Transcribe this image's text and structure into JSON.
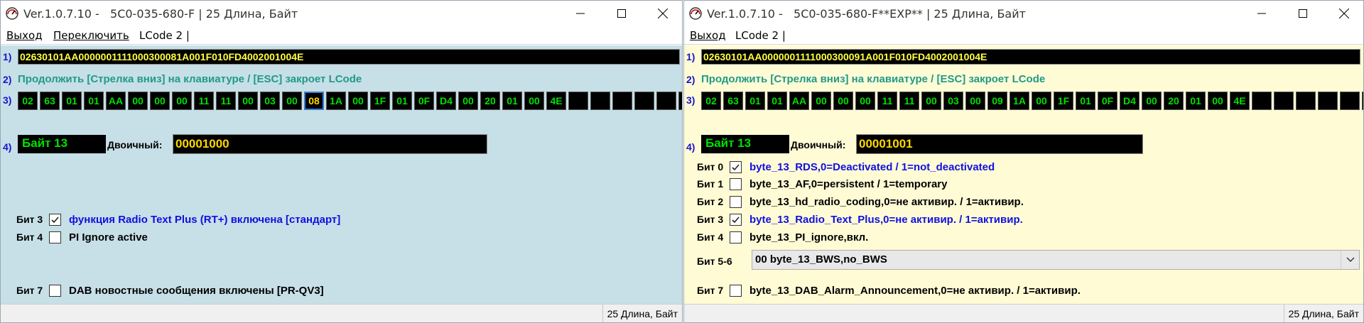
{
  "left": {
    "title": "Ver.1.0.7.10 -   5C0-035-680-F | 25 Длина, Байт",
    "menu": {
      "exit": "Выход",
      "switch": "Переключить",
      "lcode": "LCode 2 |"
    },
    "row_numbers": [
      "1)",
      "2)",
      "3)",
      "4)"
    ],
    "coding_string": "02630101AA0000001111000300081A001F010FD4002001004E",
    "hint": "Продолжить [Стрелка вниз] на клавиатуре / [ESC] закроет LCode",
    "bytes": [
      "02",
      "63",
      "01",
      "01",
      "AA",
      "00",
      "00",
      "00",
      "11",
      "11",
      "00",
      "03",
      "00",
      "08",
      "1A",
      "00",
      "1F",
      "01",
      "0F",
      "D4",
      "00",
      "20",
      "01",
      "00",
      "4E",
      "",
      "",
      "",
      "",
      "",
      ""
    ],
    "selected_byte_index": 13,
    "byte_label": "Байт 13",
    "binary_caption": "Двоичный:",
    "binary_value": "00001000",
    "bits": [
      {
        "label": "Бит 3",
        "checked": true,
        "text": "функция Radio Text Plus (RT+) включена [стандарт]",
        "color": "blue"
      },
      {
        "label": "Бит 4",
        "checked": false,
        "text": "PI Ignore active",
        "color": "black"
      },
      {
        "label": "Бит 7",
        "checked": false,
        "text": "DAB новостные сообщения включены [PR-QV3]",
        "color": "black"
      }
    ],
    "status": "25 Длина, Байт"
  },
  "right": {
    "title": "Ver.1.0.7.10 -   5C0-035-680-F**EXP** | 25 Длина, Байт",
    "menu": {
      "exit": "Выход",
      "lcode": "LCode 2 |"
    },
    "row_numbers": [
      "1)",
      "2)",
      "3)",
      "4)"
    ],
    "coding_string": "02630101AA0000001111000300091A001F010FD4002001004E",
    "hint": "Продолжить [Стрелка вниз] на клавиатуре / [ESC] закроет LCode",
    "bytes": [
      "02",
      "63",
      "01",
      "01",
      "AA",
      "00",
      "00",
      "00",
      "11",
      "11",
      "00",
      "03",
      "00",
      "09",
      "1A",
      "00",
      "1F",
      "01",
      "0F",
      "D4",
      "00",
      "20",
      "01",
      "00",
      "4E",
      "",
      "",
      "",
      "",
      "",
      ""
    ],
    "byte_label": "Байт 13",
    "binary_caption": "Двоичный:",
    "binary_value": "00001001",
    "bits": [
      {
        "label": "Бит 0",
        "checked": true,
        "text": "byte_13_RDS,0=Deactivated / 1=not_deactivated",
        "color": "blue"
      },
      {
        "label": "Бит 1",
        "checked": false,
        "text": "byte_13_AF,0=persistent / 1=temporary",
        "color": "black"
      },
      {
        "label": "Бит 2",
        "checked": false,
        "text": "byte_13_hd_radio_coding,0=не активир. / 1=активир.",
        "color": "black"
      },
      {
        "label": "Бит 3",
        "checked": true,
        "text": "byte_13_Radio_Text_Plus,0=не активир. / 1=активир.",
        "color": "blue"
      },
      {
        "label": "Бит 4",
        "checked": false,
        "text": "byte_13_PI_ignore,вкл.",
        "color": "black"
      },
      {
        "label": "Бит 7",
        "checked": false,
        "text": "byte_13_DAB_Alarm_Announcement,0=не активир. / 1=активир.",
        "color": "black"
      }
    ],
    "bit56": {
      "label": "Бит 5-6",
      "value": "00 byte_13_BWS,no_BWS"
    },
    "status": "25 Длина, Байт"
  },
  "icons": {
    "app": "gauge-icon",
    "minimize": "minimize-icon",
    "maximize": "maximize-icon",
    "close": "close-icon",
    "check": "check-icon",
    "dropdown": "chevron-down-icon"
  }
}
